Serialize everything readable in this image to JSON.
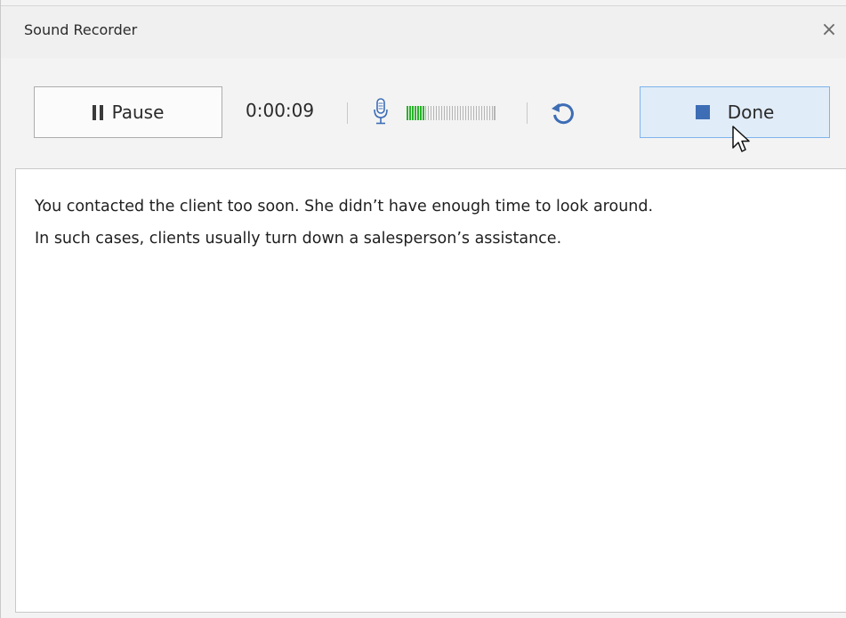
{
  "window": {
    "title": "Sound Recorder",
    "close_glyph": "×"
  },
  "toolbar": {
    "pause_label": "Pause",
    "elapsed_time": "0:00:09",
    "input_level_fraction": 0.2,
    "done_label": "Done",
    "icons": {
      "pause": "pause-icon",
      "microphone": "microphone-icon",
      "restart": "restart-icon",
      "stop": "stop-icon"
    }
  },
  "transcript": {
    "lines": [
      "You contacted the client too soon. She didn’t have enough time to look around.",
      "In such cases, clients usually turn down  a salesperson’s assistance."
    ]
  },
  "colors": {
    "accent_blue": "#3d6db5",
    "done_bg": "#e0ecf8",
    "level_green": "#28b428"
  }
}
